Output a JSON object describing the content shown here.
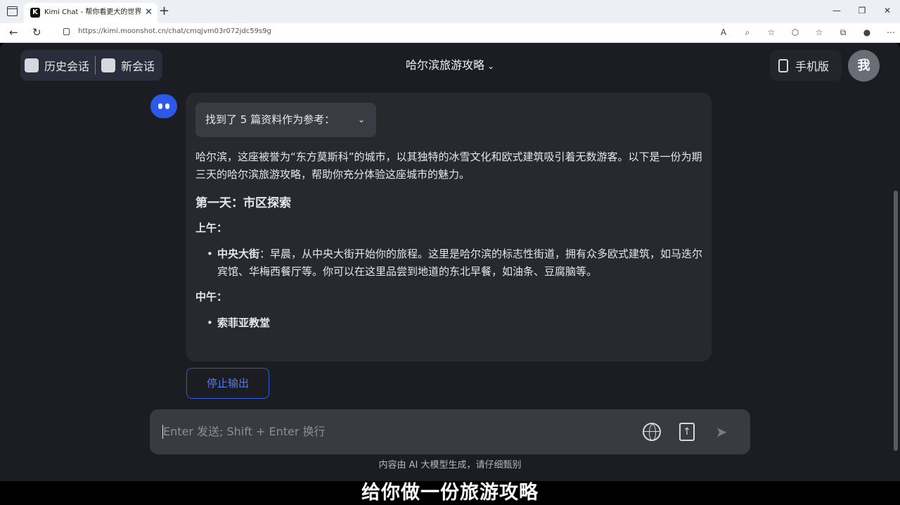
{
  "browser": {
    "tab_title": "Kimi Chat - 帮你看更大的世界",
    "tab_favicon_letter": "K",
    "tab_close": "✕",
    "new_tab": "+",
    "url": "https://kimi.moonshot.cn/chat/cmqjvm03r072jdc59s9g",
    "win_minimize": "—",
    "win_restore": "❐",
    "win_close": "✕",
    "nav_back": "←",
    "nav_reload": "↻",
    "extensions": [
      "A",
      "⌕",
      "☆",
      "⬡",
      "☆",
      "⧉",
      "●",
      "⋯"
    ]
  },
  "header": {
    "history_label": "历史会话",
    "new_chat_label": "新会话",
    "conversation_title": "哈尔滨旅游攻略",
    "title_chevron": "⌄",
    "mobile_label": "手机版",
    "avatar_text": "我"
  },
  "message": {
    "references_label": "找到了 5 篇资料作为参考：",
    "references_chevron": "⌄",
    "intro": "哈尔滨，这座被誉为“东方莫斯科”的城市，以其独特的冰雪文化和欧式建筑吸引着无数游客。以下是一份为期三天的哈尔滨旅游攻略，帮助你充分体验这座城市的魅力。",
    "day1_heading": "第一天：市区探索",
    "morning_heading": "上午：",
    "morning_item_title": "中央大街",
    "morning_item_text": "：早晨，从中央大街开始你的旅程。这里是哈尔滨的标志性街道，拥有众多欧式建筑，如马迭尔宾馆、华梅西餐厅等。你可以在这里品尝到地道的东北早餐，如油条、豆腐脑等。",
    "noon_heading": "中午：",
    "noon_item_title": "索菲亚教堂"
  },
  "stop_button_label": "停止输出",
  "input": {
    "placeholder": "Enter 发送; Shift + Enter 换行",
    "send_icon": "➤",
    "upload_icon": "↑"
  },
  "footer_note": "内容由 AI 大模型生成，请仔细甄别",
  "subtitle": "给你做一份旅游攻略"
}
